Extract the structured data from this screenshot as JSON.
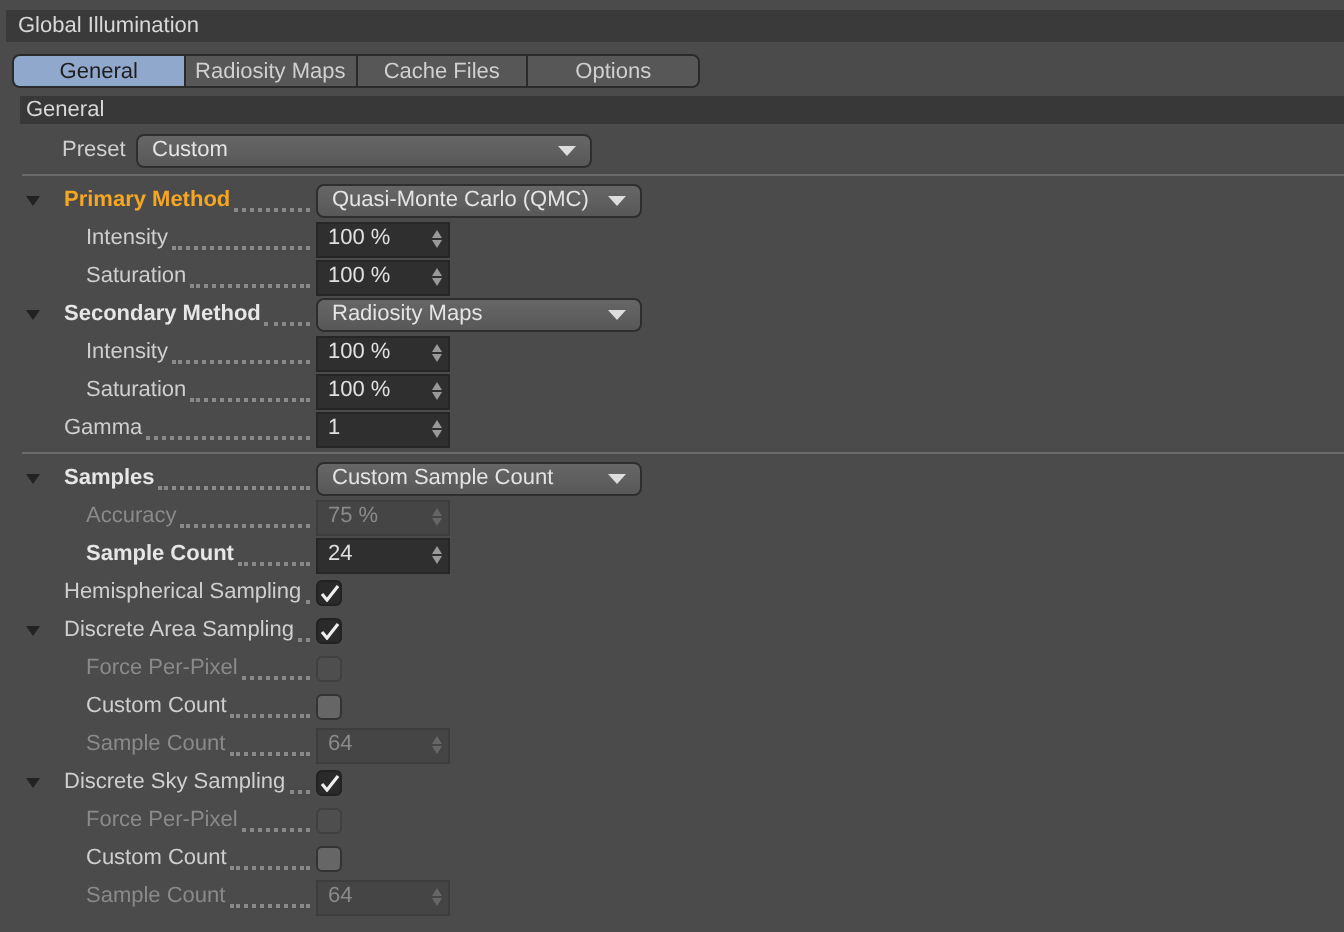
{
  "panel": {
    "title": "Global Illumination"
  },
  "tabs": [
    {
      "label": "General",
      "selected": true
    },
    {
      "label": "Radiosity Maps",
      "selected": false
    },
    {
      "label": "Cache Files",
      "selected": false
    },
    {
      "label": "Options",
      "selected": false
    }
  ],
  "section": {
    "title": "General"
  },
  "preset": {
    "label": "Preset",
    "value": "Custom"
  },
  "groups": [
    [
      {
        "kind": "dropdown",
        "label": "Primary Method",
        "value": "Quasi-Monte Carlo (QMC)",
        "highlighted": true,
        "bold": true,
        "expanded": true,
        "children": [
          {
            "kind": "number",
            "label": "Intensity",
            "value": "100 %",
            "disabled": false
          },
          {
            "kind": "number",
            "label": "Saturation",
            "value": "100 %",
            "disabled": false
          }
        ]
      },
      {
        "kind": "dropdown",
        "label": "Secondary Method",
        "value": "Radiosity Maps",
        "highlighted": false,
        "bold": true,
        "expanded": true,
        "children": [
          {
            "kind": "number",
            "label": "Intensity",
            "value": "100 %",
            "disabled": false
          },
          {
            "kind": "number",
            "label": "Saturation",
            "value": "100 %",
            "disabled": false
          }
        ]
      },
      {
        "kind": "number",
        "label": "Gamma",
        "value": "1",
        "disabled": false
      }
    ],
    [
      {
        "kind": "dropdown",
        "label": "Samples",
        "value": "Custom Sample Count",
        "highlighted": false,
        "bold": true,
        "expanded": true,
        "children": [
          {
            "kind": "number",
            "label": "Accuracy",
            "value": "75 %",
            "disabled": true
          },
          {
            "kind": "number",
            "label": "Sample Count",
            "value": "24",
            "disabled": false,
            "bold": true
          }
        ]
      },
      {
        "kind": "checkbox",
        "label": "Hemispherical Sampling",
        "checked": true,
        "disabled": false
      },
      {
        "kind": "checkbox",
        "label": "Discrete Area Sampling",
        "checked": true,
        "disabled": false,
        "expanded": true,
        "children": [
          {
            "kind": "checkbox",
            "label": "Force Per-Pixel",
            "checked": false,
            "disabled": true
          },
          {
            "kind": "checkbox",
            "label": "Custom Count",
            "checked": false,
            "disabled": false
          },
          {
            "kind": "number",
            "label": "Sample Count",
            "value": "64",
            "disabled": true
          }
        ]
      },
      {
        "kind": "checkbox",
        "label": "Discrete Sky Sampling",
        "checked": true,
        "disabled": false,
        "expanded": true,
        "children": [
          {
            "kind": "checkbox",
            "label": "Force Per-Pixel",
            "checked": false,
            "disabled": true
          },
          {
            "kind": "checkbox",
            "label": "Custom Count",
            "checked": false,
            "disabled": false
          },
          {
            "kind": "number",
            "label": "Sample Count",
            "value": "64",
            "disabled": true
          }
        ]
      }
    ]
  ]
}
